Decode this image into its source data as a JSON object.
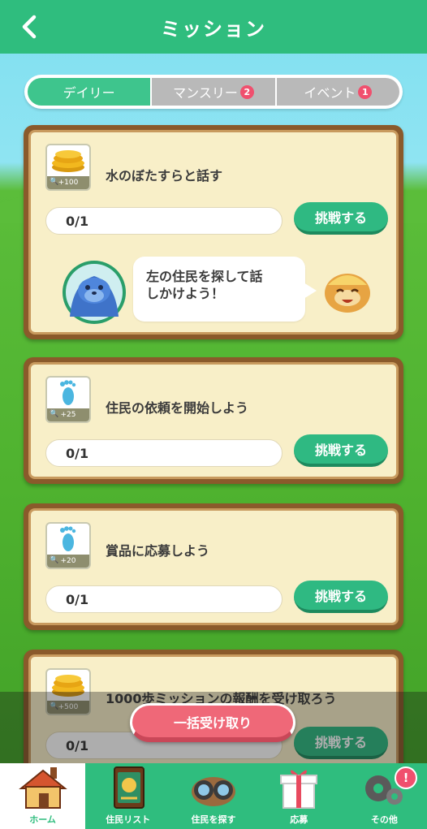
{
  "header": {
    "title": "ミッション"
  },
  "tabs": [
    {
      "label": "デイリー",
      "badge": ""
    },
    {
      "label": "マンスリー",
      "badge": "2"
    },
    {
      "label": "イベント",
      "badge": "1"
    }
  ],
  "missions": [
    {
      "reward_amount": "+100",
      "reward_icon": "coin-stack-icon",
      "text": "水のぼたすらと話す",
      "progress": "0/1",
      "button": "挑戦する"
    },
    {
      "reward_amount": "+25",
      "reward_icon": "footprint-icon",
      "text": "住民の依頼を開始しよう",
      "progress": "0/1",
      "button": "挑戦する"
    },
    {
      "reward_amount": "+20",
      "reward_icon": "footprint-icon",
      "text": "賞品に応募しよう",
      "progress": "0/1",
      "button": "挑戦する"
    },
    {
      "reward_amount": "+500",
      "reward_icon": "coin-stack-icon",
      "text": "1000歩ミッションの報酬を受け取ろう",
      "progress": "0/1",
      "button": "挑戦する"
    }
  ],
  "hint_bubble": {
    "line1": "左の住民を探して話",
    "line2": "しかけよう！"
  },
  "bulk_receive": {
    "label": "一括受け取り"
  },
  "bottom_nav": [
    {
      "label": "ホーム",
      "icon": "house-icon",
      "active": true
    },
    {
      "label": "住民リスト",
      "icon": "resident-book-icon"
    },
    {
      "label": "住民を探す",
      "icon": "binoculars-icon"
    },
    {
      "label": "応募",
      "icon": "gift-box-icon"
    },
    {
      "label": "その他",
      "icon": "gears-icon",
      "badge": "!"
    }
  ],
  "colors": {
    "accent": "#2fbd7e",
    "card_bg": "#f8efc8",
    "button": "#2fb982",
    "bulk_button": "#ef6878",
    "badge": "#f0506e"
  }
}
